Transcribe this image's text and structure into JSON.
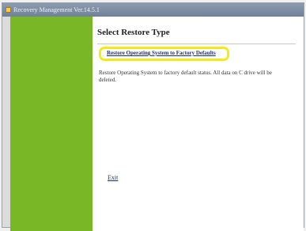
{
  "window": {
    "title": "Recovery Management Ver.14.5.1"
  },
  "header": {
    "title": "Select Restore Type"
  },
  "restore_option": {
    "label": "Restore Operating System to Factory Defaults",
    "description": "Restore Operating System to factory default status. All data on C drive will be deleted."
  },
  "footer": {
    "exit_label": "Exit"
  },
  "colors": {
    "sidebar_green": "#7ab727",
    "highlight_yellow": "#f0ec1c"
  }
}
